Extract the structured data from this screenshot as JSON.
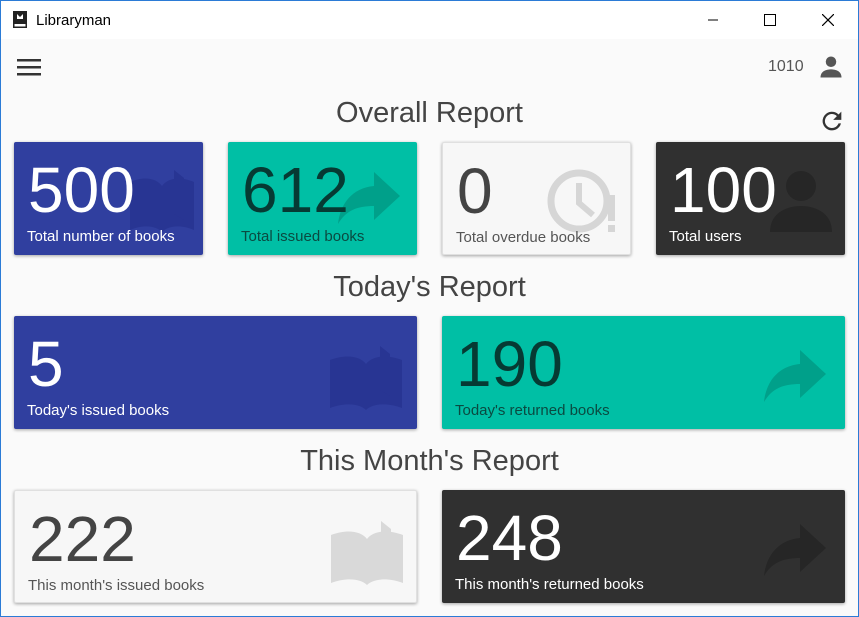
{
  "window": {
    "title": "Libraryman"
  },
  "appbar": {
    "user_id": "1010"
  },
  "sections": {
    "overall": {
      "title": "Overall Report"
    },
    "today": {
      "title": "Today's Report"
    },
    "month": {
      "title": "This Month's Report"
    }
  },
  "cards": {
    "total_books": {
      "value": "500",
      "label": "Total number of books",
      "icon": "book-icon"
    },
    "total_issued": {
      "value": "612",
      "label": "Total issued books",
      "icon": "forward-arrow-icon"
    },
    "total_overdue": {
      "value": "0",
      "label": "Total overdue books",
      "icon": "clock-alert-icon"
    },
    "total_users": {
      "value": "100",
      "label": "Total users",
      "icon": "person-icon"
    },
    "today_issued": {
      "value": "5",
      "label": "Today's issued books",
      "icon": "book-icon"
    },
    "today_returned": {
      "value": "190",
      "label": "Today's returned books",
      "icon": "forward-arrow-icon"
    },
    "month_issued": {
      "value": "222",
      "label": "This month's issued books",
      "icon": "book-icon"
    },
    "month_returned": {
      "value": "248",
      "label": "This month's returned books",
      "icon": "forward-arrow-icon"
    }
  },
  "colors": {
    "blue": "#303f9f",
    "teal": "#00bfa5",
    "white": "#f7f7f7",
    "dark": "#303030"
  }
}
